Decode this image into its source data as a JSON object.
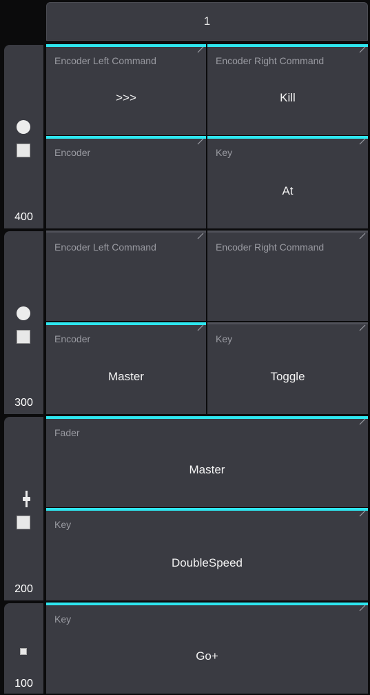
{
  "header": {
    "page_number": "1"
  },
  "sections": [
    {
      "id": "400",
      "number": "400",
      "cells": [
        {
          "label": "Encoder Left Command",
          "value": ">>>"
        },
        {
          "label": "Encoder Right Command",
          "value": "Kill"
        },
        {
          "label": "Encoder",
          "value": ""
        },
        {
          "label": "Key",
          "value": "At"
        }
      ]
    },
    {
      "id": "300",
      "number": "300",
      "cells": [
        {
          "label": "Encoder Left Command",
          "value": ""
        },
        {
          "label": "Encoder Right Command",
          "value": ""
        },
        {
          "label": "Encoder",
          "value": "Master"
        },
        {
          "label": "Key",
          "value": "Toggle"
        }
      ]
    },
    {
      "id": "200",
      "number": "200",
      "cells": [
        {
          "label": "Fader",
          "value": "Master"
        },
        {
          "label": "Key",
          "value": "DoubleSpeed"
        }
      ]
    },
    {
      "id": "100",
      "number": "100",
      "cells": [
        {
          "label": "Key",
          "value": "Go+"
        }
      ]
    }
  ],
  "colors": {
    "accent": "#2ee6ef",
    "panel": "#3a3b42",
    "background": "#0b0b0c"
  }
}
